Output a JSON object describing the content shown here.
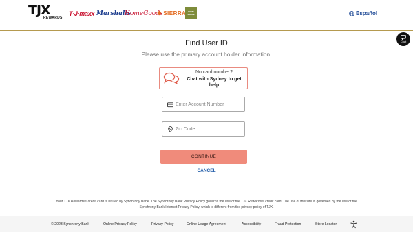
{
  "header": {
    "brand_tjx": "TJX",
    "brand_rewards": "REWARDS",
    "brands": {
      "tjmaxx": "T·J·maxx",
      "marshalls": "Marshalls",
      "homegoods": "HomeGoods",
      "sierra": "SIERRA",
      "homesense": "HOME SENSE"
    },
    "language_link": "Español",
    "accent_color": "#b59a4f"
  },
  "chat_fab": {
    "label": "Chat",
    "icon": "chat-bubble-icon"
  },
  "main": {
    "title": "Find User ID",
    "subtitle": "Please use the primary account holder information.",
    "chat_prompt": {
      "line1": "No card number?",
      "line2": "Chat with Sydney to get help",
      "icon": "chat-bubbles-icon",
      "border_color": "#e98b80"
    },
    "account_field": {
      "placeholder": "Enter Account Number",
      "value": "",
      "icon": "card-icon"
    },
    "zip_field": {
      "placeholder": "Zip Code",
      "value": "",
      "icon": "location-pin-icon"
    },
    "continue_button": "CONTINUE",
    "continue_color": "#f08b7b",
    "cancel_link": "CANCEL"
  },
  "disclaimer": "Your TJX Rewards® credit card is issued by Synchrony Bank. The Synchrony Bank Privacy Policy governs the use of the TJX Rewards® credit card. The use of this site is governed by the use of the Synchrony Bank Internet Privacy Policy, which is different from the privacy policy of TJX.",
  "footer": {
    "copyright": "© 2023 Synchrony Bank",
    "links": [
      "Online Privacy Policy",
      "Privacy Policy",
      "Online Usage Agreement",
      "Accessibility",
      "Fraud Protection",
      "Store Locator"
    ],
    "accessibility_icon": "accessibility-icon"
  }
}
